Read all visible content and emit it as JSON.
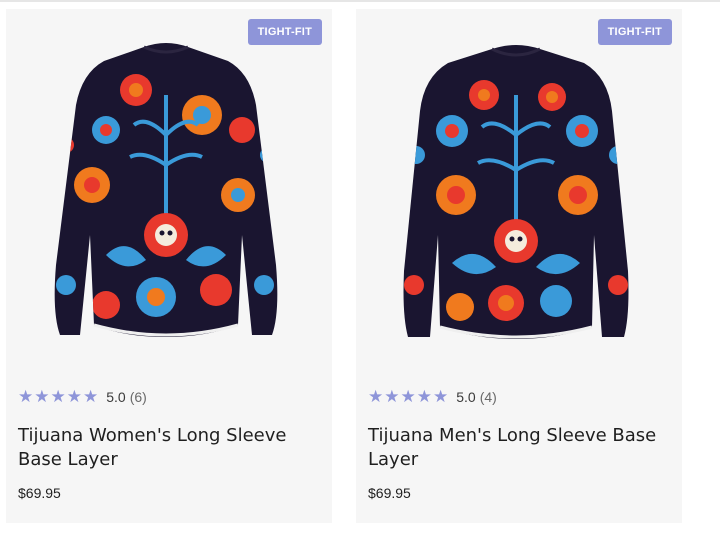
{
  "products": [
    {
      "badge": "TIGHT-FIT",
      "image_alt": "Tijuana women's long sleeve base layer jersey with floral skull print",
      "rating_value": "5.0",
      "rating_count": "(6)",
      "stars": 5,
      "title": "Tijuana Women's Long Sleeve Base Layer",
      "price": "$69.95"
    },
    {
      "badge": "TIGHT-FIT",
      "image_alt": "Tijuana men's long sleeve base layer jersey with floral skull print",
      "rating_value": "5.0",
      "rating_count": "(4)",
      "stars": 5,
      "title": "Tijuana Men's Long Sleeve Base Layer",
      "price": "$69.95"
    }
  ],
  "colors": {
    "accent": "#8e95d9",
    "card_bg": "#f6f6f6",
    "jersey_base": "#1a1530",
    "print_red": "#e8392d",
    "print_blue": "#3a9ad9",
    "print_orange": "#f07a1e"
  }
}
